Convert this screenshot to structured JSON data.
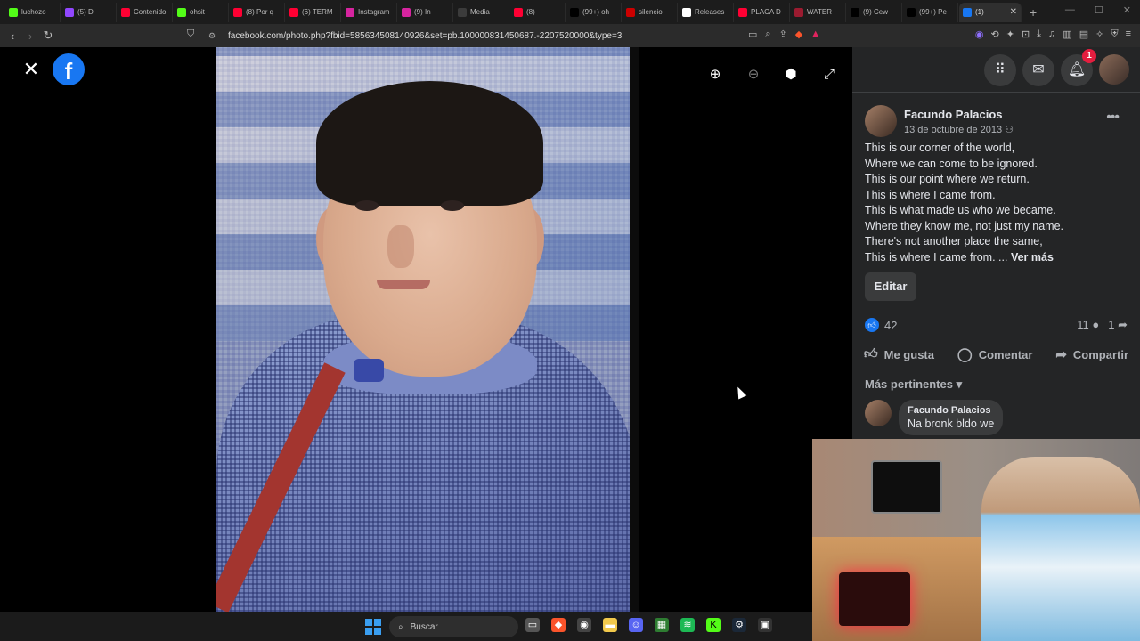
{
  "browser": {
    "tabs": [
      {
        "label": "luchozo",
        "color": "#53fc18"
      },
      {
        "label": "(5) D",
        "color": "#9147ff"
      },
      {
        "label": "Contenido",
        "color": "#ff0033"
      },
      {
        "label": "ohsit",
        "color": "#53fc18"
      },
      {
        "label": "(8) Por q",
        "color": "#ff0033"
      },
      {
        "label": "(6) TERM",
        "color": "#ff0033"
      },
      {
        "label": "Instagram",
        "color": "#d6249f"
      },
      {
        "label": "(9) In",
        "color": "#d6249f"
      },
      {
        "label": "Media",
        "color": "#3b3b3b"
      },
      {
        "label": "(8)",
        "color": "#ff0033"
      },
      {
        "label": "(99+) oh",
        "color": "#000000"
      },
      {
        "label": "silencio",
        "color": "#cc0000"
      },
      {
        "label": "Releases",
        "color": "#ffffff"
      },
      {
        "label": "PLACA D",
        "color": "#ff0033"
      },
      {
        "label": "WATER",
        "color": "#9b1b30"
      },
      {
        "label": "(9) Cew",
        "color": "#000000"
      },
      {
        "label": "(99+) Pe",
        "color": "#000000"
      },
      {
        "label": "(1)",
        "color": "#1877f2",
        "active": true
      }
    ],
    "url": "facebook.com/photo.php?fbid=585634508140926&set=pb.100000831450687.-2207520000&type=3"
  },
  "viewer": {
    "logo_letter": "f",
    "icons": [
      "close-icon",
      "zoom-in-icon",
      "zoom-out-icon",
      "tag-icon",
      "fullscreen-icon"
    ]
  },
  "topnav": {
    "notifications_count": "1"
  },
  "post": {
    "author": "Facundo Palacios",
    "date": "13 de octubre de 2013",
    "caption_lines": [
      "This is our corner of the world,",
      "Where we can come to be ignored.",
      "This is our point where we return.",
      "This is where I came from.",
      "This is what made us who we became.",
      "Where they know me, not just my name.",
      "There's not another place the same,",
      "This is where I came from. ..."
    ],
    "see_more": "Ver más",
    "edit_label": "Editar",
    "likes": "42",
    "comments_count": "11",
    "shares_count": "1",
    "like_label": "Me gusta",
    "comment_label": "Comentar",
    "share_label": "Compartir",
    "sort_label": "Más pertinentes",
    "comment": {
      "author": "Facundo Palacios",
      "text": "Na bronk bldo we"
    }
  },
  "taskbar": {
    "search_label": "Buscar"
  }
}
